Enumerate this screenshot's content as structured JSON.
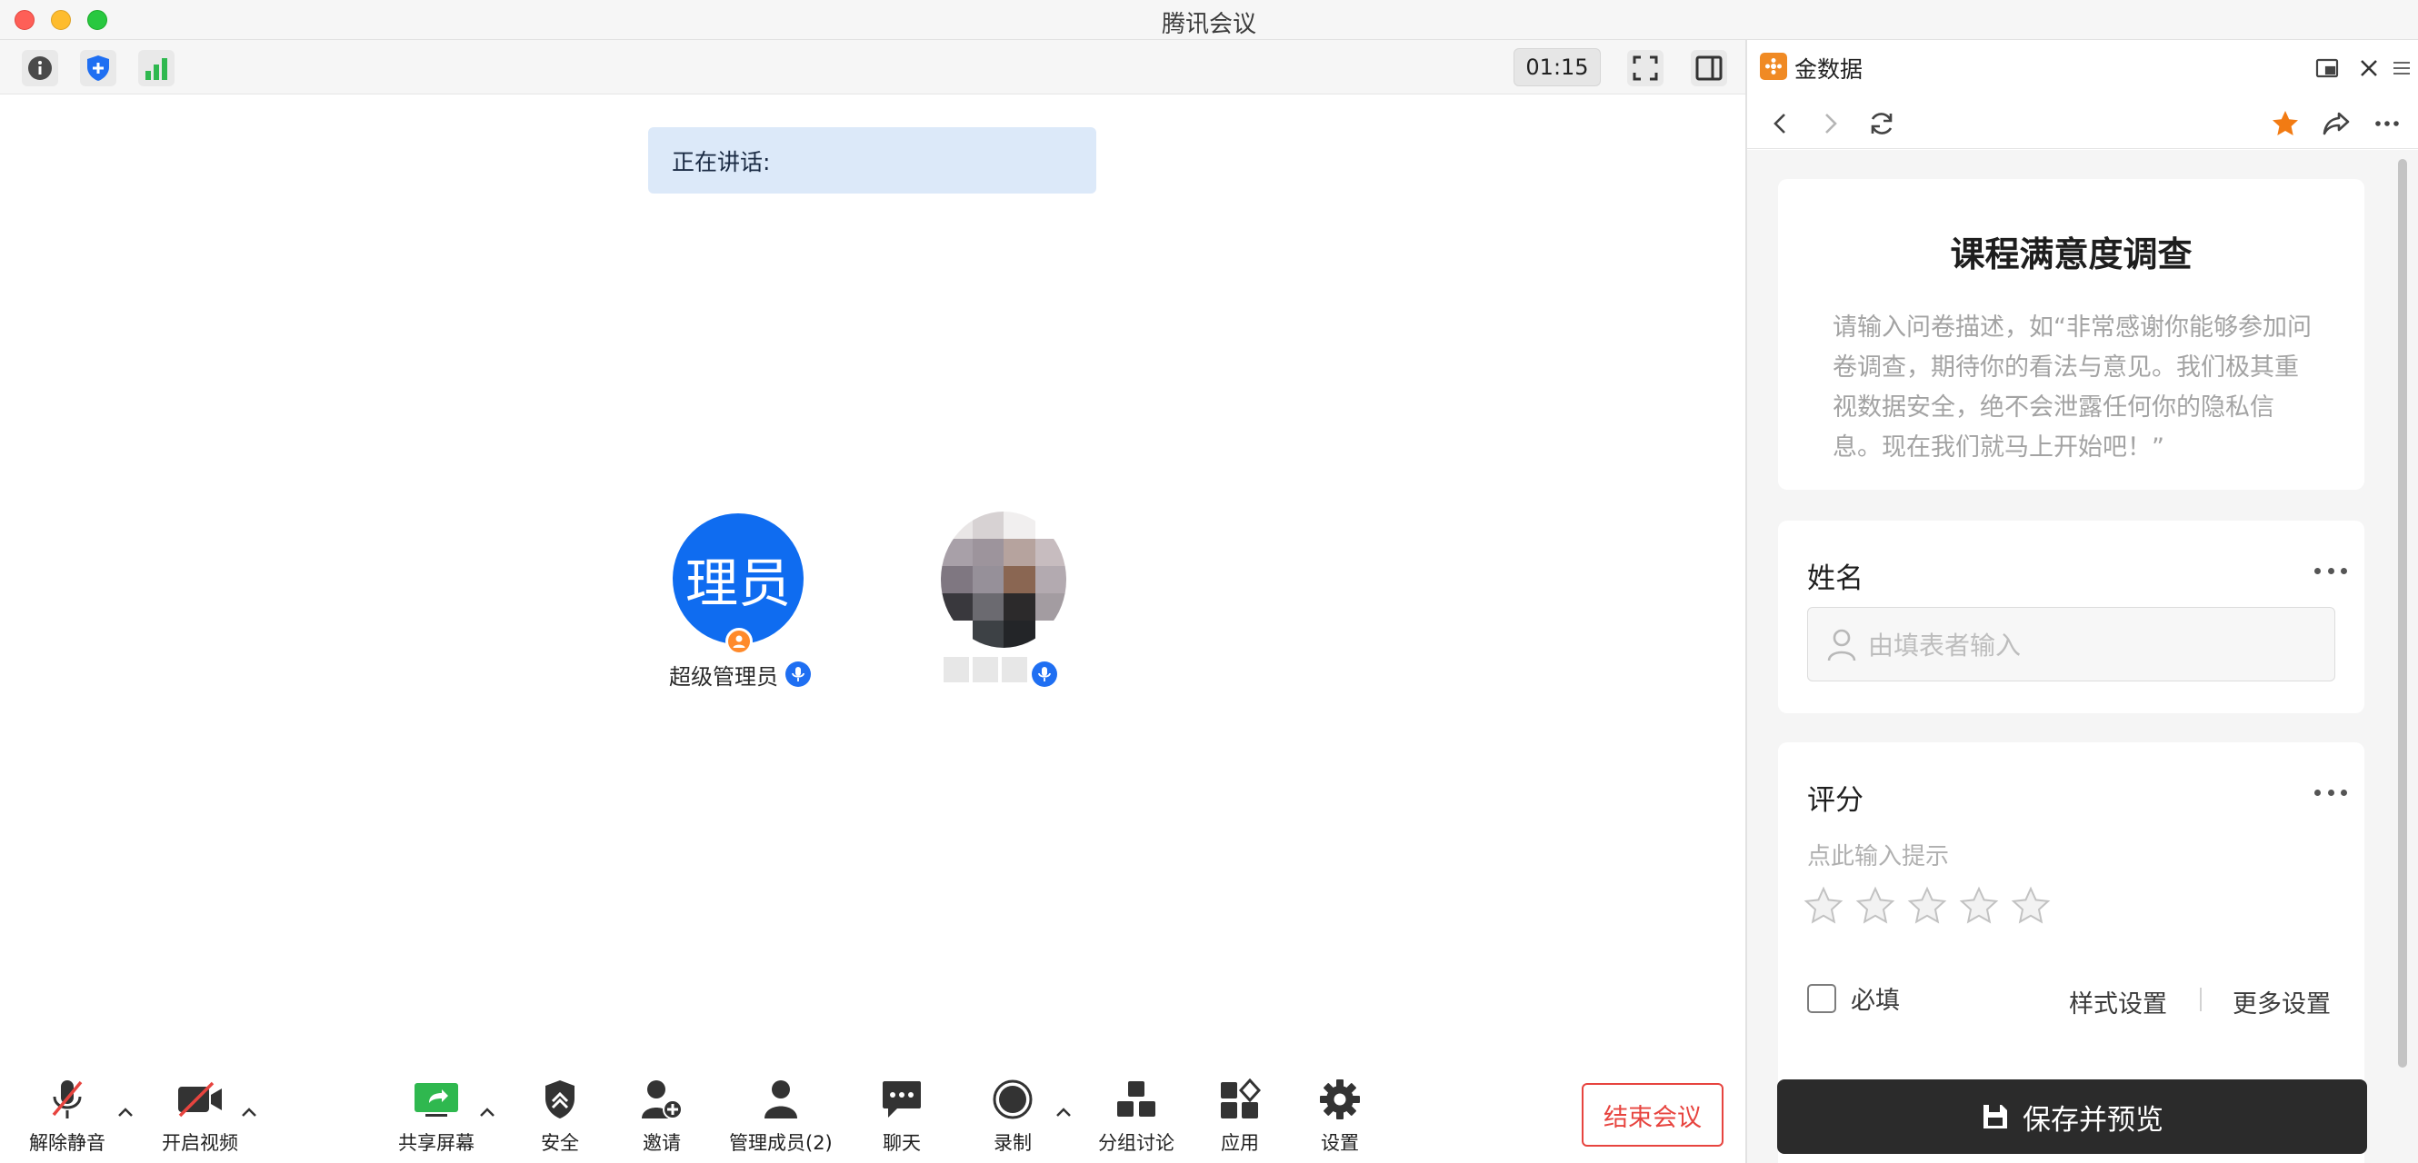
{
  "window": {
    "title": "腾讯会议"
  },
  "topbar": {
    "timer": "01:15"
  },
  "stage": {
    "speaking_label": "正在讲话:",
    "participants": [
      {
        "avatar_text": "理员",
        "name": "超级管理员",
        "avatar_color": "#0f6cf0"
      },
      {
        "avatar_text": "",
        "name": "",
        "blurred": true
      }
    ]
  },
  "toolbar": {
    "unmute": "解除静音",
    "start_video": "开启视频",
    "share_screen": "共享屏幕",
    "security": "安全",
    "invite": "邀请",
    "manage_members": "管理成员(2)",
    "chat": "聊天",
    "record": "录制",
    "breakout": "分组讨论",
    "apps": "应用",
    "settings": "设置",
    "end_meeting": "结束会议"
  },
  "panel": {
    "title": "金数据",
    "form": {
      "title": "课程满意度调查",
      "description": "请输入问卷描述，如“非常感谢你能够参加问卷调查，期待你的看法与意见。我们极其重视数据安全，绝不会泄露任何你的隐私信息。现在我们就马上开始吧！”",
      "questions": [
        {
          "label": "姓名",
          "placeholder": "由填表者输入"
        },
        {
          "label": "评分",
          "hint": "点此输入提示",
          "stars": 5,
          "required_label": "必填",
          "style_settings": "样式设置",
          "more_settings": "更多设置"
        }
      ]
    },
    "save_button": "保存并预览"
  },
  "colors": {
    "accent_blue": "#0f6cf0",
    "end_red": "#e7443f",
    "star_orange": "#f27b13",
    "signal_green": "#2fb84f"
  }
}
